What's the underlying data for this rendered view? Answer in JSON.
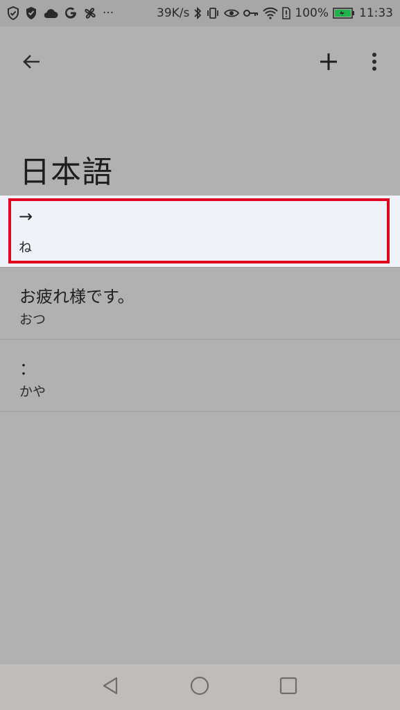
{
  "status_bar": {
    "left_icons": [
      "shield-check-icon",
      "shield-icon",
      "cloud-icon",
      "google-icon",
      "fan-icon",
      "more-dots-icon"
    ],
    "network_speed": "39K/s",
    "battery_percent": "100%",
    "time": "11:33",
    "battery_color": "#1fb34a"
  },
  "toolbar": {
    "back_icon": "arrow-left-icon",
    "add_icon": "plus-icon",
    "menu_icon": "more-vertical-icon"
  },
  "page": {
    "title": "日本語"
  },
  "entries": [
    {
      "word": "→",
      "reading": "ね",
      "selected": true
    },
    {
      "word": "お疲れ様です。",
      "reading": "おつ",
      "selected": false
    },
    {
      "word": "：",
      "reading": "かや",
      "selected": false
    }
  ],
  "colors": {
    "background": "#b1b1b2",
    "selected_row": "#eff2f8",
    "highlight_border": "#e0051f"
  },
  "nav_bar": {
    "back_icon": "triangle-back-icon",
    "home_icon": "circle-home-icon",
    "recents_icon": "square-recents-icon"
  }
}
